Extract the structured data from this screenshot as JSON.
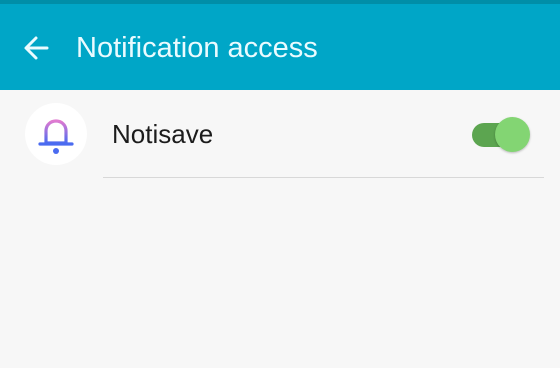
{
  "header": {
    "title": "Notification access",
    "back_icon": "arrow-left-icon",
    "color": "#00a6c7"
  },
  "apps": [
    {
      "name": "Notisave",
      "icon": "bell-icon",
      "enabled": true
    }
  ],
  "colors": {
    "toggle_on_track": "#5ca550",
    "toggle_on_thumb": "#83d573",
    "background": "#f7f7f7"
  }
}
